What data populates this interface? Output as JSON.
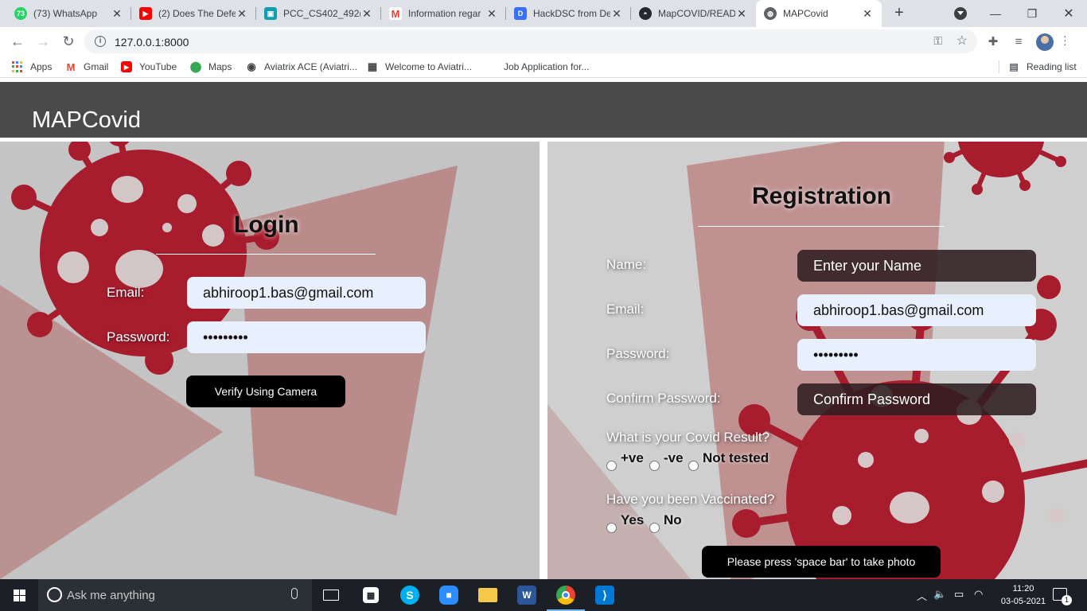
{
  "browser": {
    "tabs": [
      {
        "title": "(73) WhatsApp",
        "badge": "73",
        "icon": "whatsapp-icon",
        "color": "#25d366"
      },
      {
        "title": "(2) Does The Defe",
        "icon": "youtube-icon",
        "color": "#ff0000"
      },
      {
        "title": "PCC_CS402_492(2",
        "icon": "classroom-icon",
        "color": "#129eaf"
      },
      {
        "title": "Information regar",
        "icon": "gmail-icon",
        "color": "#ea4335"
      },
      {
        "title": "HackDSC from De",
        "icon": "devfolio-icon",
        "color": "#3770ff"
      },
      {
        "title": "MapCOVID/READ",
        "icon": "github-icon",
        "color": "#24292e"
      },
      {
        "title": "MAPCovid",
        "icon": "globe-icon",
        "color": "#5f6368",
        "active": true
      }
    ],
    "url": "127.0.0.1:8000",
    "bookmarks": [
      {
        "label": "Apps",
        "icon": "apps-grid-icon"
      },
      {
        "label": "Gmail",
        "icon": "gmail-icon",
        "glyph": "M",
        "color": "#ea4335"
      },
      {
        "label": "YouTube",
        "icon": "youtube-icon",
        "glyph": "▶",
        "color": "#ff0000"
      },
      {
        "label": "Maps",
        "icon": "maps-icon",
        "glyph": "●",
        "color": "#34a853"
      },
      {
        "label": "Aviatrix ACE (Aviatri...",
        "icon": "aviatrix-icon",
        "glyph": "◉",
        "color": "#444"
      },
      {
        "label": "Welcome to Aviatri...",
        "icon": "document-icon",
        "glyph": "▦",
        "color": "#444"
      },
      {
        "label": "Job Application for...",
        "icon": "blank-icon",
        "glyph": "",
        "color": "#444"
      }
    ],
    "reading_list": "Reading list"
  },
  "app": {
    "brand": "MAPCovid",
    "colors": {
      "header": "#4a4a4a",
      "virus": "#a81d2e",
      "panel": "#c9c9c9"
    }
  },
  "login": {
    "title": "Login",
    "email_label": "Email:",
    "email_value": "abhiroop1.bas@gmail.com",
    "password_label": "Password:",
    "password_value": "•••••••••",
    "verify_button": "Verify Using Camera"
  },
  "registration": {
    "title": "Registration",
    "name_label": "Name:",
    "name_placeholder": "Enter your Name",
    "email_label": "Email:",
    "email_value": "abhiroop1.bas@gmail.com",
    "password_label": "Password:",
    "password_value": "•••••••••",
    "confirm_label": "Confirm Password:",
    "confirm_placeholder": "Confirm Password",
    "covid_question": "What is your Covid Result?",
    "covid_options": [
      "+ve",
      "-ve",
      "Not tested"
    ],
    "vaccine_question": "Have you been Vaccinated?",
    "vaccine_options": [
      "Yes",
      "No"
    ],
    "photo_button": "Please press 'space bar' to take photo"
  },
  "taskbar": {
    "search_placeholder": "Ask me anything",
    "time": "11:20",
    "date": "03-05-2021",
    "notification_count": "1"
  }
}
